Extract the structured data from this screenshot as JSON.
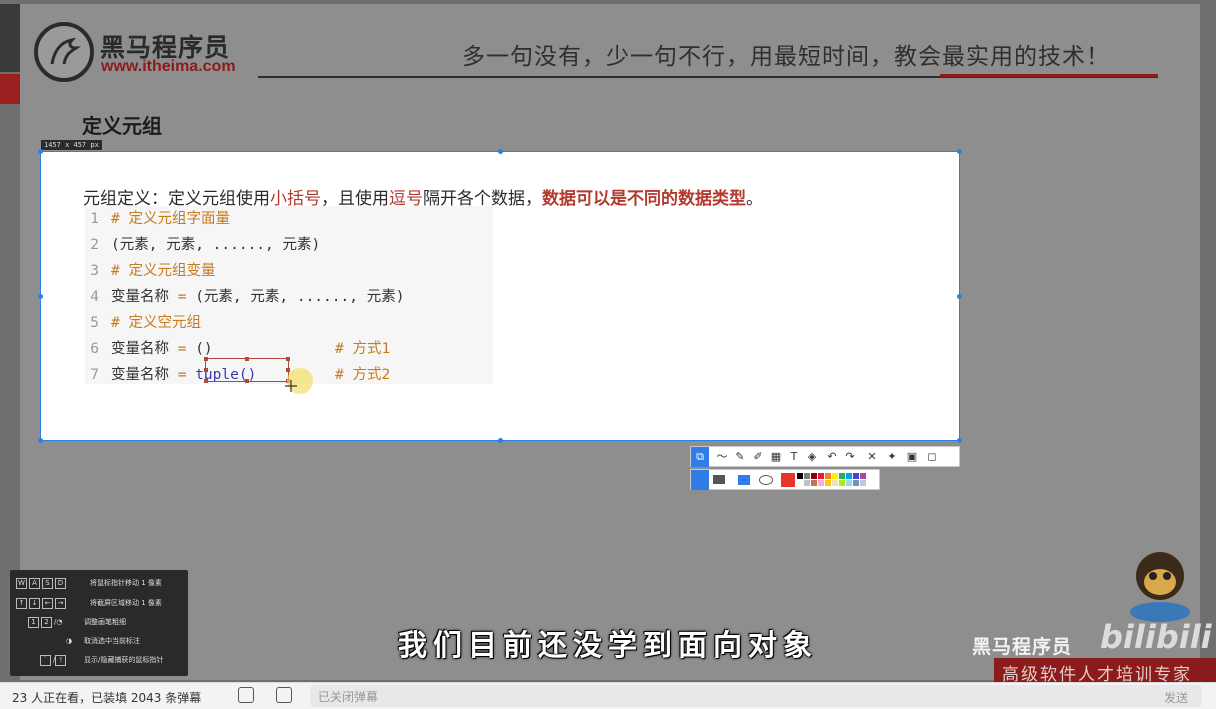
{
  "header": {
    "brand_name": "黑马程序员",
    "brand_url": "www.itheima.com",
    "slogan": "多一句没有，少一句不行，用最短时间，教会最实用的技术！"
  },
  "slide": {
    "title": "定义元组",
    "dimension_badge": "1457 x 457  px",
    "definition": {
      "part1": "元组定义：定义元组使用",
      "hl1": "小括号",
      "part2": "，且使用",
      "hl2": "逗号",
      "part3": "隔开各个数据，",
      "hl3": "数据可以是不同的数据类型",
      "part4": "。"
    },
    "code_lines": [
      {
        "num": "1",
        "comment": "# 定义元组字面量"
      },
      {
        "num": "2",
        "text": "(元素, 元素, ......, 元素)"
      },
      {
        "num": "3",
        "comment": "# 定义元组变量"
      },
      {
        "num": "4",
        "var": "变量名称",
        "eq": "=",
        "text": "(元素, 元素, ......, 元素)"
      },
      {
        "num": "5",
        "comment": "# 定义空元组"
      },
      {
        "num": "6",
        "var": "变量名称",
        "eq": "=",
        "text": "()",
        "comment": "# 方式1"
      },
      {
        "num": "7",
        "var": "变量名称",
        "eq": "=",
        "kw": "tuple()",
        "comment": "# 方式2"
      }
    ]
  },
  "toolbar": {
    "icons": [
      "select-icon",
      "curve-icon",
      "pencil-icon",
      "marker-icon",
      "mosaic-icon",
      "text-icon",
      "eraser-icon",
      "undo-icon",
      "redo-icon",
      "close-icon",
      "pin-icon",
      "save-icon",
      "copy-icon"
    ],
    "row2_icons": [
      "pen-size-icon",
      "rectangle-icon",
      "ellipse-icon"
    ],
    "active_color": "#e8352b",
    "palette": [
      "#000000",
      "#7f7f7f",
      "#880015",
      "#ed1c24",
      "#ff7f27",
      "#fff200",
      "#22b14c",
      "#00a2e8",
      "#3f48cc",
      "#a349a4",
      "#ffffff",
      "#c3c3c3",
      "#b97a57",
      "#ffaec9",
      "#ffc90e",
      "#efe4b0",
      "#b5e61d",
      "#99d9ea",
      "#7092be",
      "#c8bfe7"
    ]
  },
  "shortcuts": [
    {
      "keys": [
        "W",
        "A",
        "S",
        "D"
      ],
      "label": "将鼠标指针移动 1 像素"
    },
    {
      "keys": [
        "↑",
        "↓",
        "←",
        "→"
      ],
      "label": "将截屏区域移动 1 像素"
    },
    {
      "keys": [
        "1",
        "2",
        "/"
      ],
      "label": "调整画笔粗细"
    },
    {
      "keys": [],
      "label": "取消选中当前标注"
    },
    {
      "keys": [
        "`",
        "/",
        "!"
      ],
      "label": "显示/隐藏捕获的鼠标指针"
    }
  ],
  "subtitle": "我们目前还没学到面向对象",
  "watermark": {
    "brand": "黑马程序员",
    "platform": "bilibili",
    "slogan": "高级软件人才培训专家"
  },
  "bottombar": {
    "status": "23 人正在看，已装填 2043 条弹幕",
    "danmaku_placeholder": "已关闭弹幕",
    "send_label": "发送"
  }
}
